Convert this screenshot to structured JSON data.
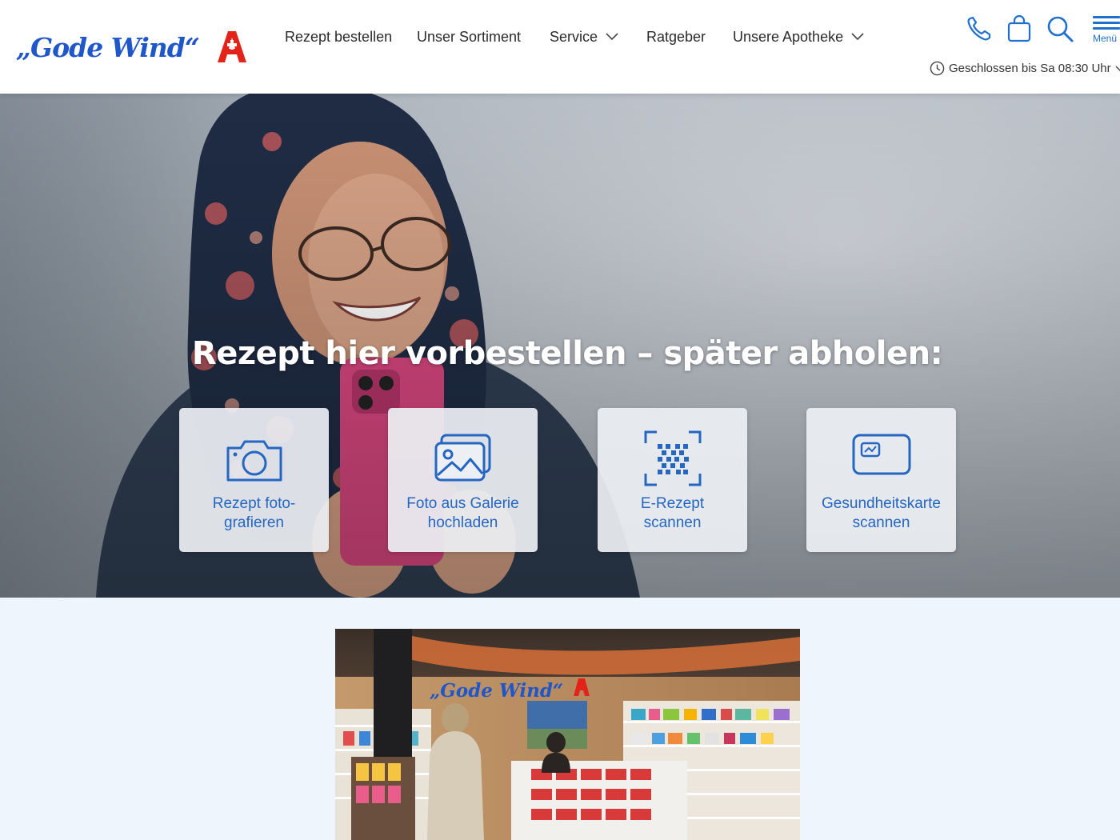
{
  "header": {
    "logo_text": "„Gode Wind“",
    "nav": [
      {
        "label": "Rezept bestellen"
      },
      {
        "label": "Unser Sortiment"
      },
      {
        "label": "Service"
      },
      {
        "label": "Ratgeber"
      },
      {
        "label": "Unsere Apotheke"
      }
    ],
    "menu_label": "Menü",
    "hours": "Geschlossen bis Sa 08:30 Uhr",
    "icons": [
      "phone-icon",
      "shopping-bag-icon",
      "search-icon",
      "hamburger-menu-icon",
      "clock-icon"
    ]
  },
  "hero": {
    "title": "Rezept hier vorbestellen – später abholen:",
    "cards": [
      {
        "line1": "Rezept foto-",
        "line2": "grafieren",
        "icon": "camera-icon"
      },
      {
        "line1": "Foto aus Galerie",
        "line2": "hochladen",
        "icon": "gallery-icon"
      },
      {
        "line1": "E-Rezept",
        "line2": "scannen",
        "icon": "qr-scan-icon"
      },
      {
        "line1": "Gesundheitskarte",
        "line2": "scannen",
        "icon": "health-card-icon"
      }
    ]
  },
  "store_sign": "„Gode Wind“",
  "colors": {
    "accent_blue": "#2566c1",
    "logo_blue": "#1f56c8",
    "pharmacy_red": "#e2231a",
    "section_bg": "#eef5fc"
  }
}
